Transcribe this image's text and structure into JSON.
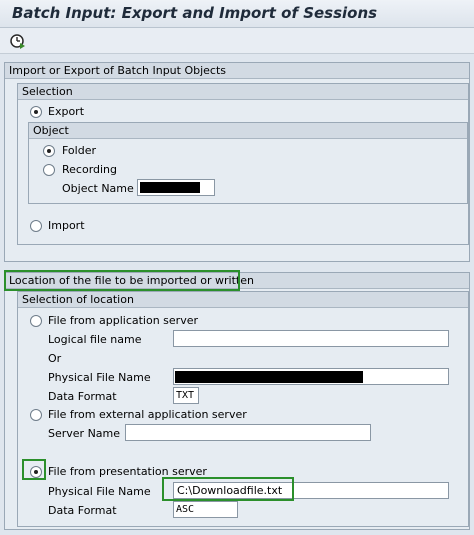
{
  "window": {
    "title": "Batch Input: Export and Import of Sessions"
  },
  "toolbar": {
    "execute_icon": "execute-clock-icon"
  },
  "frame_objects": {
    "title": "Import or Export of Batch Input Objects",
    "selection": {
      "title": "Selection",
      "export_label": "Export",
      "object": {
        "title": "Object",
        "folder_label": "Folder",
        "recording_label": "Recording",
        "object_name_label": "Object Name",
        "object_name_value": ""
      },
      "import_label": "Import"
    }
  },
  "frame_location": {
    "title": "Location of the file to be imported or written",
    "selection": {
      "title": "Selection of location",
      "app_server_label": "File from application server",
      "logical_file_label": "Logical file name",
      "logical_file_value": "",
      "or_label": "Or",
      "physical_file_label": "Physical File Name",
      "physical_file_value": "",
      "data_format_label": "Data Format",
      "data_format_value": "TXT",
      "ext_server_label": "File from external application server",
      "server_name_label": "Server Name",
      "server_name_value": "",
      "presentation_label": "File from presentation server",
      "pres_physical_label": "Physical File Name",
      "pres_physical_value": "C:\\Downloadfile.txt",
      "pres_format_label": "Data Format",
      "pres_format_value": "ASC"
    }
  },
  "colors": {
    "highlight": "#2b8f2b"
  }
}
